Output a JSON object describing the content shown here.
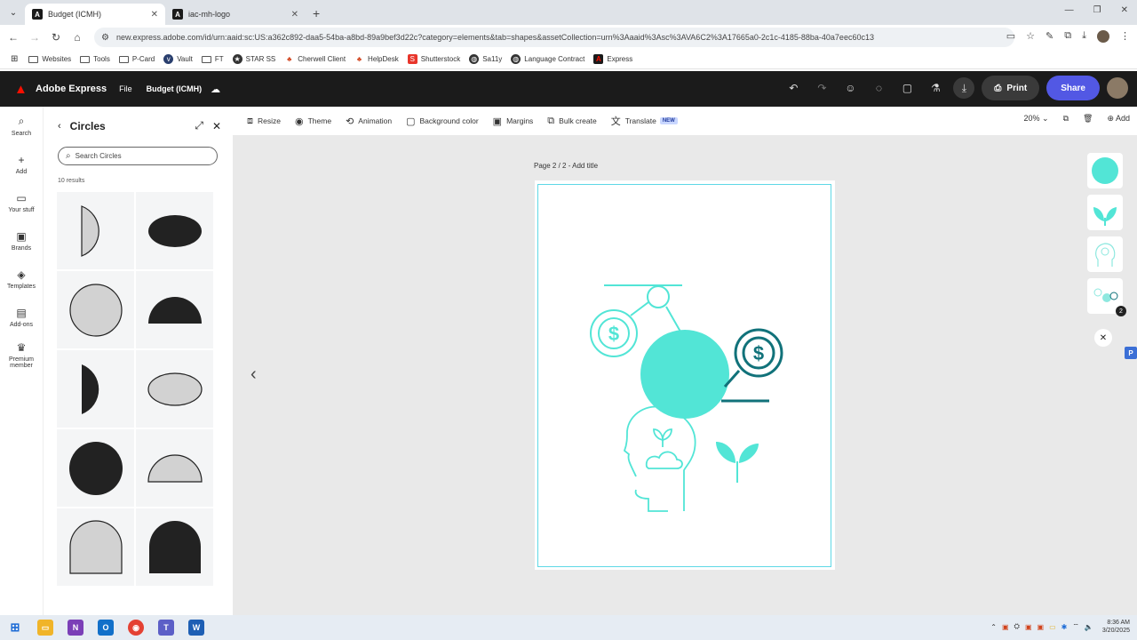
{
  "browser": {
    "tabs": [
      {
        "title": "Budget (ICMH)",
        "active": true
      },
      {
        "title": "iac-mh-logo",
        "active": false
      }
    ],
    "url": "new.express.adobe.com/id/urn:aaid:sc:US:a362c892-daa5-54ba-a8bd-89a9bef3d22c?category=elements&tab=shapes&assetCollection=urn%3Aaaid%3Asc%3AVA6C2%3A17665a0-2c1c-4185-88ba-40a7eec60c13",
    "bookmarks": [
      "Websites",
      "Tools",
      "P-Card",
      "Vault",
      "FT",
      "STAR SS",
      "Cherwell Client",
      "HelpDesk",
      "Shutterstock",
      "Sa11y",
      "Language Contract",
      "Express"
    ]
  },
  "app": {
    "name": "Adobe Express",
    "file_menu": "File",
    "doc_title": "Budget (ICMH)",
    "print_label": "Print",
    "share_label": "Share"
  },
  "rail": [
    {
      "label": "Search",
      "icon": "search-icon"
    },
    {
      "label": "Add",
      "icon": "plus-icon"
    },
    {
      "label": "Your stuff",
      "icon": "folder-icon"
    },
    {
      "label": "Brands",
      "icon": "brand-icon"
    },
    {
      "label": "Templates",
      "icon": "templates-icon"
    },
    {
      "label": "Add-ons",
      "icon": "addons-icon"
    },
    {
      "label": "Premium member",
      "icon": "crown-icon"
    }
  ],
  "panel": {
    "title": "Circles",
    "search_placeholder": "Search Circles",
    "results": "10 results"
  },
  "toolbar": {
    "items": [
      {
        "label": "Resize",
        "icon": "resize-icon"
      },
      {
        "label": "Theme",
        "icon": "palette-icon"
      },
      {
        "label": "Animation",
        "icon": "animation-icon"
      },
      {
        "label": "Background color",
        "icon": "square-icon"
      },
      {
        "label": "Margins",
        "icon": "margins-icon"
      },
      {
        "label": "Bulk create",
        "icon": "bulk-icon"
      },
      {
        "label": "Translate",
        "icon": "translate-icon"
      }
    ],
    "new_badge": "NEW",
    "zoom": "20%",
    "add_label": "Add"
  },
  "canvas": {
    "page_label": "Page 2 / 2 - Add title",
    "accent": "#52e5d6",
    "dark_accent": "#11727a",
    "thumb_count": "2"
  },
  "taskbar": {
    "time": "8:36 AM",
    "date": "3/20/2025"
  }
}
